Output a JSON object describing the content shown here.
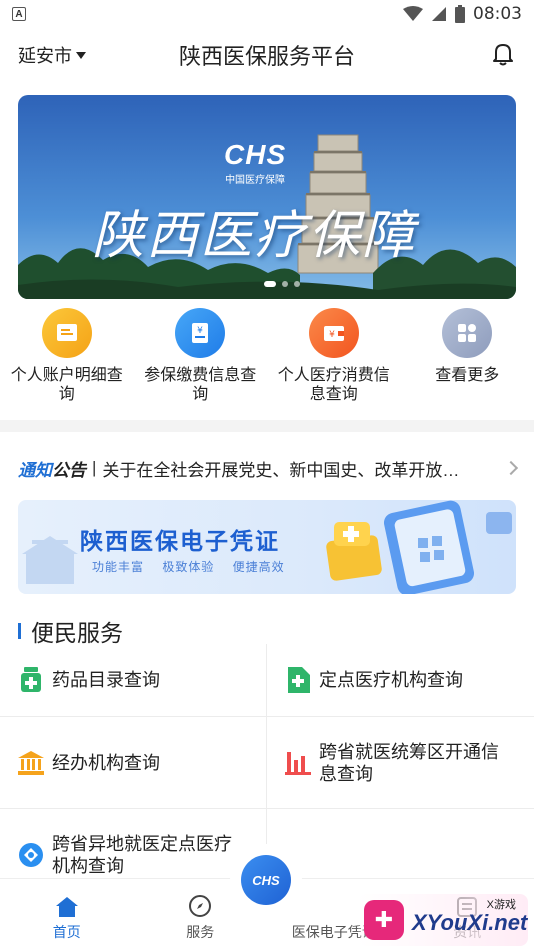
{
  "status_bar": {
    "time": "08:03",
    "notification_icon": "A"
  },
  "header": {
    "city": "延安市",
    "title": "陕西医保服务平台"
  },
  "banner": {
    "logo": "CHS",
    "logo_sub": "中国医疗保障",
    "text": "陕西医疗保障",
    "slides": 3,
    "active_slide": 1
  },
  "quick_actions": [
    {
      "label": "个人账户明细查询",
      "icon": "document-icon",
      "color": "#f5b21c"
    },
    {
      "label": "参保缴费信息查询",
      "icon": "receipt-icon",
      "color": "#2a8ff0"
    },
    {
      "label": "个人医疗消费信息查询",
      "icon": "wallet-icon",
      "color": "#f5612d"
    },
    {
      "label": "查看更多",
      "icon": "grid-icon",
      "color": "#9aa8c8"
    }
  ],
  "notice": {
    "tag_a": "通知",
    "tag_b": "公告",
    "text": "关于在全社会开展党史、新中国史、改革开放史、社会主义发展史宣传教育的通知"
  },
  "e_card": {
    "title": "陕西医保电子凭证",
    "subtitle": "功能丰富 极致体验 便捷高效"
  },
  "services": {
    "title": "便民服务",
    "items": [
      {
        "label": "药品目录查询",
        "icon": "medicine-icon",
        "color": "#2fb56a"
      },
      {
        "label": "定点医疗机构查询",
        "icon": "hospital-icon",
        "color": "#2fb56a"
      },
      {
        "label": "经办机构查询",
        "icon": "institution-icon",
        "color": "#f5a31c"
      },
      {
        "label": "跨省就医统筹区开通信息查询",
        "icon": "bar-chart-icon",
        "color": "#ef4d4d"
      },
      {
        "label": "跨省异地就医定点医疗机构查询",
        "icon": "location-icon",
        "color": "#2a8ff0"
      }
    ]
  },
  "tabbar": {
    "tabs": [
      {
        "label": "首页",
        "icon": "home-icon"
      },
      {
        "label": "服务",
        "icon": "compass-icon"
      },
      {
        "label": "医保电子凭证",
        "icon": "chs-scan-icon"
      },
      {
        "label": "资讯",
        "icon": "news-icon"
      }
    ],
    "center_button": "CHS"
  },
  "watermark": {
    "top": "X游戏",
    "main": "XYouXi.net"
  }
}
